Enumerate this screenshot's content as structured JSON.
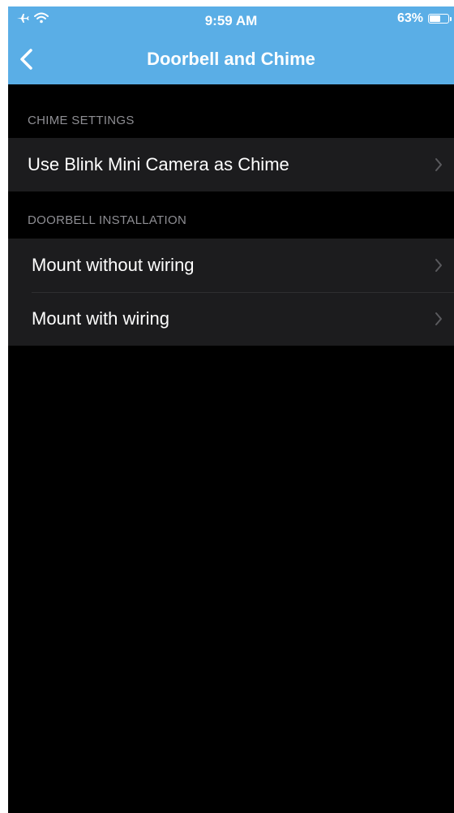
{
  "status_bar": {
    "time": "9:59 AM",
    "battery_percent": "63%",
    "battery_level": 0.63,
    "icons": [
      "airplane-icon",
      "wifi-icon",
      "battery-icon"
    ]
  },
  "nav": {
    "title": "Doorbell and Chime",
    "back_icon": "chevron-left-icon"
  },
  "sections": {
    "chime": {
      "header": "CHIME SETTINGS",
      "items": [
        {
          "label": "Use Blink Mini Camera as Chime"
        }
      ]
    },
    "installation": {
      "header": "DOORBELL INSTALLATION",
      "items": [
        {
          "label": "Mount without wiring"
        },
        {
          "label": "Mount with wiring"
        }
      ]
    }
  },
  "colors": {
    "header_bg": "#5aaee6",
    "screen_bg": "#000000",
    "row_bg": "#1c1c1e",
    "section_text": "#8e8e93"
  }
}
